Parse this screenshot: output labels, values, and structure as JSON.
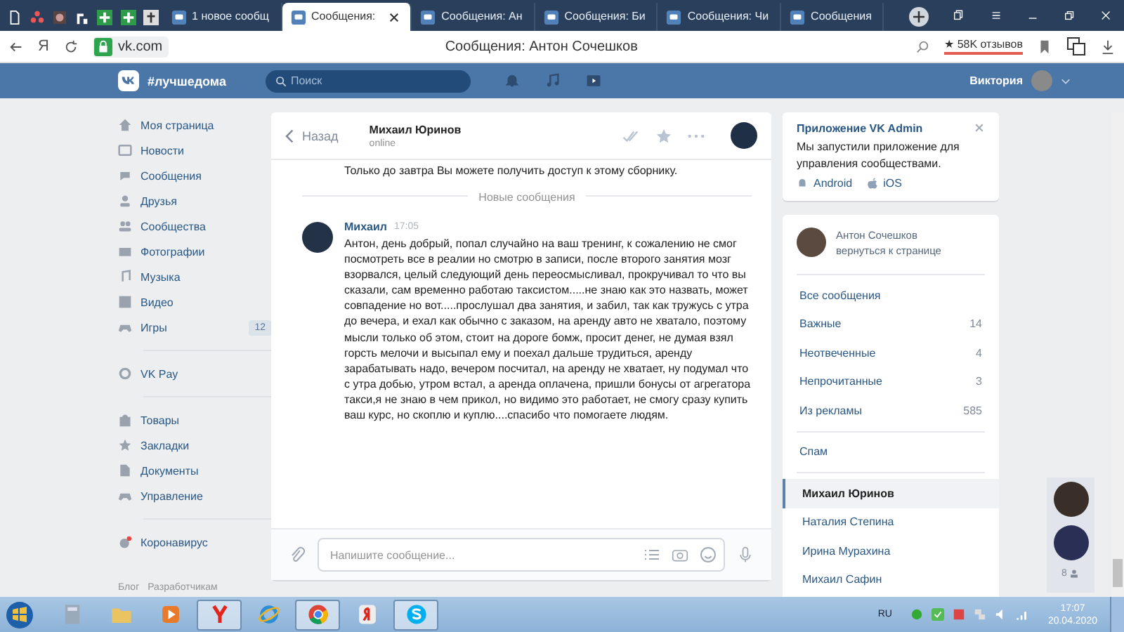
{
  "browser": {
    "tabs": [
      {
        "kind": "pinned"
      },
      {
        "kind": "pinned"
      },
      {
        "kind": "pinned"
      },
      {
        "kind": "pinned"
      },
      {
        "kind": "pinned"
      },
      {
        "kind": "pinned"
      },
      {
        "kind": "pinned"
      },
      {
        "kind": "page",
        "title": "1 новое сообщ",
        "selected": false
      },
      {
        "kind": "page",
        "title": "Сообщения:",
        "selected": true
      },
      {
        "kind": "page",
        "title": "Сообщения: Ан",
        "selected": false
      },
      {
        "kind": "page",
        "title": "Сообщения: Би",
        "selected": false
      },
      {
        "kind": "page",
        "title": "Сообщения: Чи",
        "selected": false
      },
      {
        "kind": "page",
        "title": "Сообщения",
        "selected": false
      }
    ],
    "address": "vk.com",
    "page_title": "Сообщения: Антон Сочешков",
    "reviews": "★ 58K отзывов",
    "yandex_key": "Я"
  },
  "header": {
    "logo": "#лучшедома",
    "search_placeholder": "Поиск",
    "user": "Виктория"
  },
  "nav": {
    "groups": [
      [
        {
          "label": "Моя страница"
        },
        {
          "label": "Новости"
        },
        {
          "label": "Сообщения"
        },
        {
          "label": "Друзья"
        },
        {
          "label": "Сообщества"
        },
        {
          "label": "Фотографии"
        },
        {
          "label": "Музыка"
        },
        {
          "label": "Видео"
        },
        {
          "label": "Игры",
          "badge": "12"
        }
      ],
      [
        {
          "label": "VK Pay"
        }
      ],
      [
        {
          "label": "Товары"
        },
        {
          "label": "Закладки"
        },
        {
          "label": "Документы"
        },
        {
          "label": "Управление"
        }
      ],
      [
        {
          "label": "Коронавирус"
        }
      ]
    ],
    "footer": [
      "Блог",
      "Разработчикам"
    ]
  },
  "chat": {
    "back": "Назад",
    "name": "Михаил Юринов",
    "status": "online",
    "previous_text": "Только до завтра Вы можете получить доступ к этому сборнику.",
    "divider": "Новые сообщения",
    "message": {
      "author": "Михаил",
      "time": "17:05",
      "text": "Антон, день добрый, попал случайно на ваш тренинг, к сожалению не смог посмотреть все в реалии но смотрю в записи, после второго занятия мозг взорвался, целый следующий день переосмысливал, прокручивал то что вы сказали, сам временно работаю таксистом.....не знаю как это назвать, может совпадение но вот.....прослушал два занятия, и забил, так как тружусь с утра до вечера, и ехал как обычно с заказом, на аренду авто не хватало, поэтому мысли только об этом, стоит на дороге бомж, просит денег, не думая взял горсть мелочи и высыпал ему и поехал дальше трудиться, аренду зарабатывать надо, вечером посчитал, на аренду не хватает, ну подумал что с утра добью, утром встал, а аренда оплачена, пришли бонусы от агрегатора такси,я не знаю в чем прикол, но видимо это работает, не смогу сразу купить ваш курс, но скоплю и куплю....спасибо что помогаете людям."
    },
    "composer_placeholder": "Напишите сообщение..."
  },
  "promo": {
    "title": "Приложение VK Admin",
    "text": "Мы запустили приложение для управления сообществами.",
    "links": [
      "Android",
      "iOS"
    ]
  },
  "inbox": {
    "profile": {
      "name": "Антон Сочешков",
      "action": "вернуться к странице"
    },
    "filters": [
      {
        "label": "Все сообщения"
      },
      {
        "label": "Важные",
        "count": "14"
      },
      {
        "label": "Неотвеченные",
        "count": "4"
      },
      {
        "label": "Непрочитанные",
        "count": "3"
      },
      {
        "label": "Из рекламы",
        "count": "585"
      }
    ],
    "spam": "Спам",
    "conversations": [
      {
        "name": "Михаил Юринов",
        "selected": true
      },
      {
        "name": "Наталия Степина",
        "selected": false
      },
      {
        "name": "Ирина Мурахина",
        "selected": false
      },
      {
        "name": "Михаил Сафин",
        "selected": false
      }
    ]
  },
  "side_strip": {
    "count": "8"
  },
  "taskbar": {
    "apps": [
      {
        "selected": false
      },
      {
        "selected": false
      },
      {
        "selected": false
      },
      {
        "selected": true
      },
      {
        "selected": false
      },
      {
        "selected": true
      },
      {
        "selected": false
      },
      {
        "selected": true
      }
    ],
    "language": "RU",
    "time": "17:07",
    "date": "20.04.2020"
  }
}
